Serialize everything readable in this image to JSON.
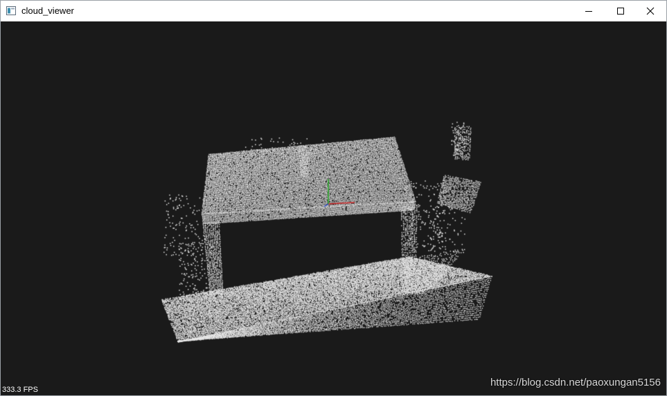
{
  "window": {
    "title": "cloud_viewer",
    "icon": "app-window-icon",
    "controls": [
      "minimize-icon",
      "maximize-icon",
      "close-icon"
    ]
  },
  "viewer": {
    "background": "#1a1a1a",
    "point_color": "#e8e8e8",
    "fps_label": "333.3 FPS",
    "axes": {
      "x_color": "#cc2222",
      "y_color": "#22aa22",
      "z_color": "#2244cc"
    }
  },
  "watermark": "https://blog.csdn.net/paoxungan5156"
}
